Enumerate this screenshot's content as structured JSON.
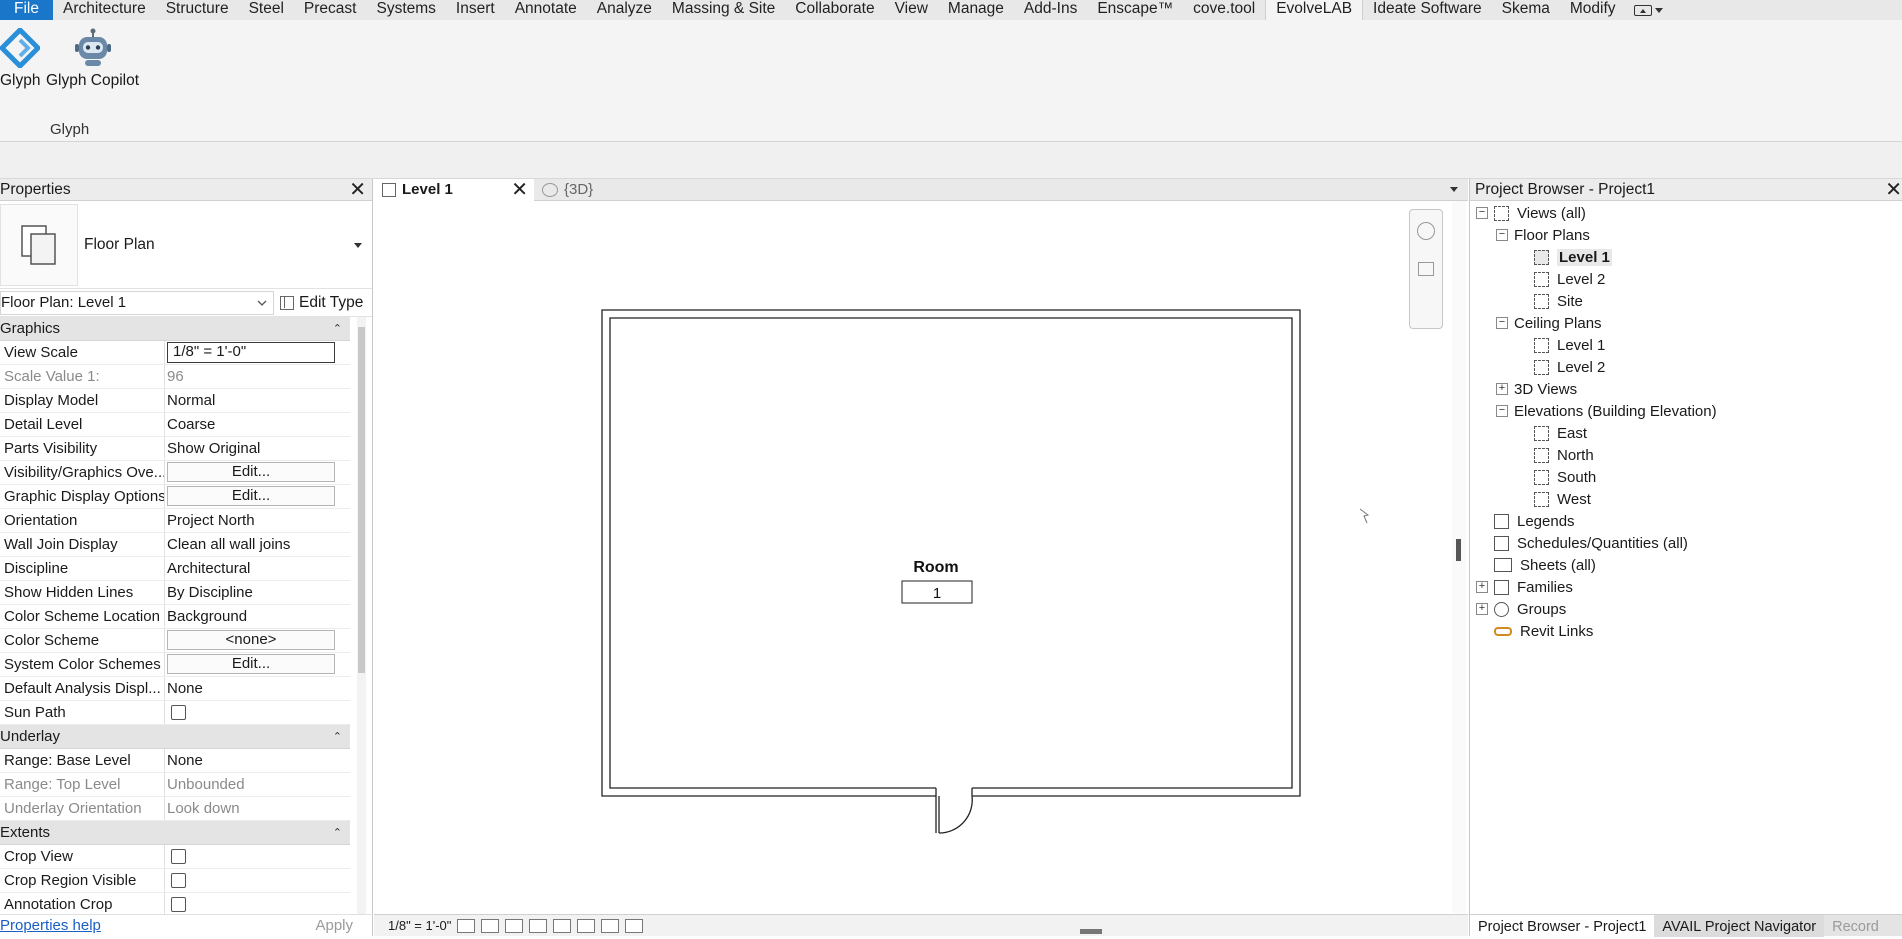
{
  "ribbon": {
    "tabs": [
      "File",
      "Architecture",
      "Structure",
      "Steel",
      "Precast",
      "Systems",
      "Insert",
      "Annotate",
      "Analyze",
      "Massing & Site",
      "Collaborate",
      "View",
      "Manage",
      "Add-Ins",
      "Enscape™",
      "cove.tool",
      "EvolveLAB",
      "Ideate Software",
      "Skema",
      "Modify"
    ],
    "active_tab": "EvolveLAB",
    "buttons": [
      {
        "label": "Glyph",
        "icon": "glyph-logo-icon"
      },
      {
        "label": "Glyph Copilot",
        "icon": "robot-icon"
      }
    ],
    "panel_label": "Glyph"
  },
  "properties": {
    "title": "Properties",
    "type_name": "Floor Plan",
    "instance_selector": "Floor Plan: Level 1",
    "edit_type_label": "Edit Type",
    "sections": [
      {
        "name": "Graphics",
        "rows": [
          {
            "name": "View Scale",
            "value": "1/8\" = 1'-0\"",
            "kind": "input"
          },
          {
            "name": "Scale Value    1:",
            "value": "96",
            "kind": "muted"
          },
          {
            "name": "Display Model",
            "value": "Normal",
            "kind": "text"
          },
          {
            "name": "Detail Level",
            "value": "Coarse",
            "kind": "text"
          },
          {
            "name": "Parts Visibility",
            "value": "Show Original",
            "kind": "text"
          },
          {
            "name": "Visibility/Graphics Ove...",
            "value": "Edit...",
            "kind": "button"
          },
          {
            "name": "Graphic Display Options",
            "value": "Edit...",
            "kind": "button"
          },
          {
            "name": "Orientation",
            "value": "Project North",
            "kind": "text"
          },
          {
            "name": "Wall Join Display",
            "value": "Clean all wall joins",
            "kind": "text"
          },
          {
            "name": "Discipline",
            "value": "Architectural",
            "kind": "text"
          },
          {
            "name": "Show Hidden Lines",
            "value": "By Discipline",
            "kind": "text"
          },
          {
            "name": "Color Scheme Location",
            "value": "Background",
            "kind": "text"
          },
          {
            "name": "Color Scheme",
            "value": "<none>",
            "kind": "button"
          },
          {
            "name": "System Color Schemes",
            "value": "Edit...",
            "kind": "button"
          },
          {
            "name": "Default Analysis Displ...",
            "value": "None",
            "kind": "text"
          },
          {
            "name": "Sun Path",
            "value": "",
            "kind": "checkbox"
          }
        ]
      },
      {
        "name": "Underlay",
        "rows": [
          {
            "name": "Range: Base Level",
            "value": "None",
            "kind": "text"
          },
          {
            "name": "Range: Top Level",
            "value": "Unbounded",
            "kind": "muted"
          },
          {
            "name": "Underlay Orientation",
            "value": "Look down",
            "kind": "muted"
          }
        ]
      },
      {
        "name": "Extents",
        "rows": [
          {
            "name": "Crop View",
            "value": "",
            "kind": "checkbox"
          },
          {
            "name": "Crop Region Visible",
            "value": "",
            "kind": "checkbox"
          },
          {
            "name": "Annotation Crop",
            "value": "",
            "kind": "checkbox"
          }
        ]
      }
    ],
    "help_link": "Properties help",
    "apply_label": "Apply"
  },
  "view": {
    "tabs": [
      {
        "label": "Level 1",
        "active": true
      },
      {
        "label": "{3D}",
        "active": false
      }
    ],
    "room_name": "Room",
    "room_number": "1",
    "status_scale": "1/8\" = 1'-0\""
  },
  "browser": {
    "title": "Project Browser - Project1",
    "tree": [
      {
        "label": "Views (all)",
        "level": 0,
        "toggle": "−",
        "icon": "views-icon"
      },
      {
        "label": "Floor Plans",
        "level": 1,
        "toggle": "−",
        "icon": ""
      },
      {
        "label": "Level 1",
        "level": 2,
        "toggle": "",
        "icon": "view-icon",
        "bold": true
      },
      {
        "label": "Level 2",
        "level": 2,
        "toggle": "",
        "icon": "view-icon"
      },
      {
        "label": "Site",
        "level": 2,
        "toggle": "",
        "icon": "view-icon"
      },
      {
        "label": "Ceiling Plans",
        "level": 1,
        "toggle": "−",
        "icon": ""
      },
      {
        "label": "Level 1",
        "level": 2,
        "toggle": "",
        "icon": "view-icon"
      },
      {
        "label": "Level 2",
        "level": 2,
        "toggle": "",
        "icon": "view-icon"
      },
      {
        "label": "3D Views",
        "level": 1,
        "toggle": "+",
        "icon": ""
      },
      {
        "label": "Elevations (Building Elevation)",
        "level": 1,
        "toggle": "−",
        "icon": ""
      },
      {
        "label": "East",
        "level": 2,
        "toggle": "",
        "icon": "view-icon"
      },
      {
        "label": "North",
        "level": 2,
        "toggle": "",
        "icon": "view-icon"
      },
      {
        "label": "South",
        "level": 2,
        "toggle": "",
        "icon": "view-icon"
      },
      {
        "label": "West",
        "level": 2,
        "toggle": "",
        "icon": "view-icon"
      },
      {
        "label": "Legends",
        "level": 0,
        "toggle": "",
        "icon": "legend-icon"
      },
      {
        "label": "Schedules/Quantities (all)",
        "level": 0,
        "toggle": "",
        "icon": "schedule-icon"
      },
      {
        "label": "Sheets (all)",
        "level": 0,
        "toggle": "",
        "icon": "sheet-icon"
      },
      {
        "label": "Families",
        "level": 0,
        "toggle": "+",
        "icon": "family-icon"
      },
      {
        "label": "Groups",
        "level": 0,
        "toggle": "+",
        "icon": "group-icon"
      },
      {
        "label": "Revit Links",
        "level": 0,
        "toggle": "",
        "icon": "link-icon"
      }
    ],
    "footer_tabs": [
      "Project Browser - Project1",
      "AVAIL Project Navigator",
      "Record"
    ]
  }
}
